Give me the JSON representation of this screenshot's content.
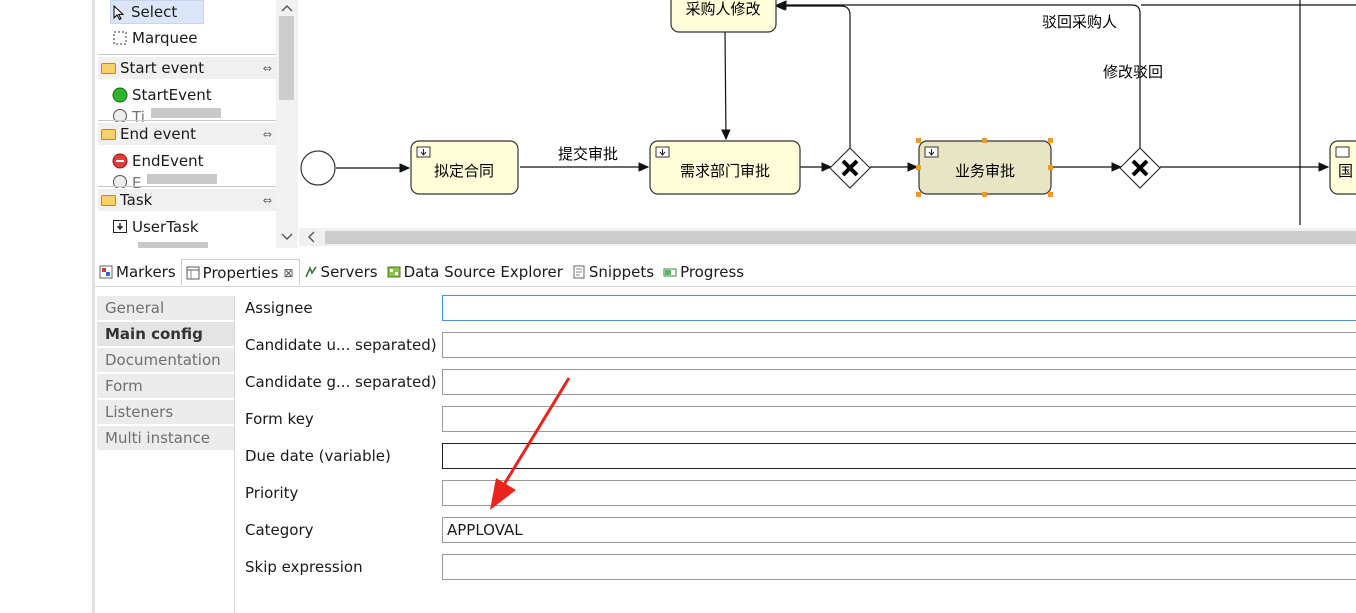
{
  "palette": {
    "tools": [
      {
        "label": "Select",
        "icon": "arrow-cursor-icon"
      },
      {
        "label": "Marquee",
        "icon": "marquee-icon"
      }
    ],
    "groups": [
      {
        "label": "Start event",
        "items": [
          {
            "label": "StartEvent"
          },
          {
            "label": "Ti"
          }
        ]
      },
      {
        "label": "End event",
        "items": [
          {
            "label": "EndEvent"
          },
          {
            "label": "E"
          }
        ]
      },
      {
        "label": "Task",
        "items": [
          {
            "label": "UserTask"
          }
        ]
      }
    ],
    "collapse_glyph": "⇔"
  },
  "diagram": {
    "tasks": [
      "采购人修改",
      "拟定合同",
      "需求部门审批",
      "业务审批",
      "国"
    ],
    "flow_labels": [
      "驳回采购人",
      "修改驳回",
      "提交审批"
    ]
  },
  "tabs": [
    {
      "label": "Markers",
      "icon": "markers-icon"
    },
    {
      "label": "Properties",
      "icon": "properties-icon",
      "close": "⊠"
    },
    {
      "label": "Servers",
      "icon": "servers-icon"
    },
    {
      "label": "Data Source Explorer",
      "icon": "data-source-icon"
    },
    {
      "label": "Snippets",
      "icon": "snippets-icon"
    },
    {
      "label": "Progress",
      "icon": "progress-icon"
    }
  ],
  "properties": {
    "nav": [
      "General",
      "Main config",
      "Documentation",
      "Form",
      "Listeners",
      "Multi instance"
    ],
    "fields": [
      {
        "label": "Assignee",
        "value": ""
      },
      {
        "label": "Candidate u... separated)",
        "value": ""
      },
      {
        "label": "Candidate g... separated)",
        "value": ""
      },
      {
        "label": "Form key",
        "value": ""
      },
      {
        "label": "Due date (variable)",
        "value": ""
      },
      {
        "label": "Priority",
        "value": ""
      },
      {
        "label": "Category",
        "value": "APPLOVAL"
      },
      {
        "label": "Skip expression",
        "value": ""
      }
    ]
  },
  "colors": {
    "task_fill": "#fefed9",
    "task_selected_fill": "#e7e5c4",
    "annotation_arrow": "#e8241c"
  }
}
